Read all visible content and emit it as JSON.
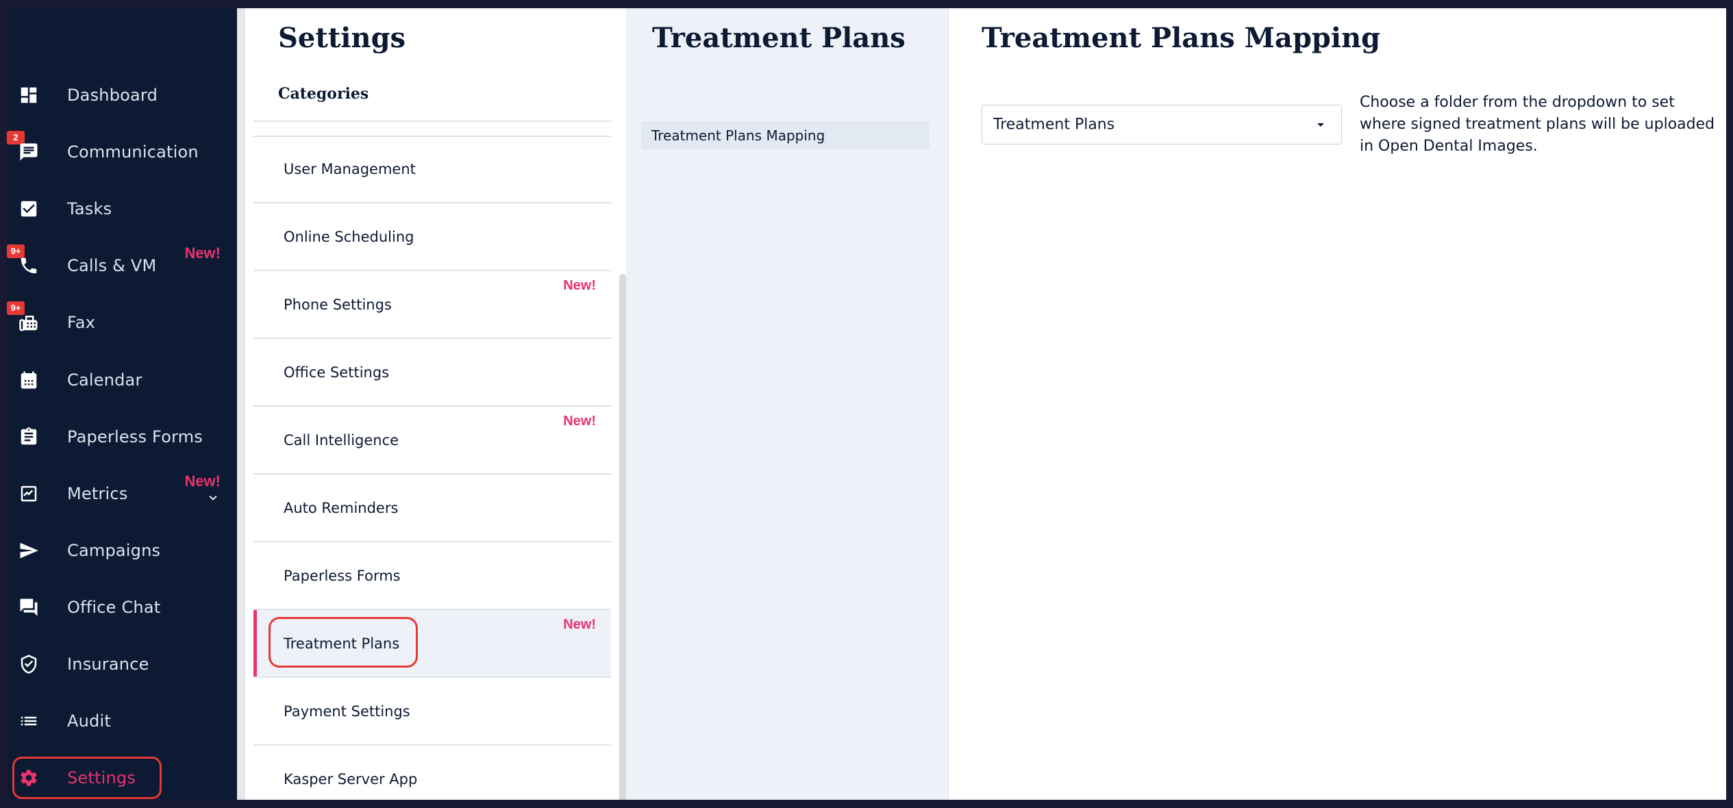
{
  "sidebar": {
    "items": [
      {
        "label": "Dashboard",
        "icon": "dashboard-icon"
      },
      {
        "label": "Communication",
        "icon": "chat-icon",
        "badge": "2"
      },
      {
        "label": "Tasks",
        "icon": "checkbox-icon"
      },
      {
        "label": "Calls & VM",
        "icon": "phone-icon",
        "badge": "9+",
        "new": "New!"
      },
      {
        "label": "Fax",
        "icon": "fax-icon",
        "badge": "9+"
      },
      {
        "label": "Calendar",
        "icon": "calendar-icon"
      },
      {
        "label": "Paperless Forms",
        "icon": "clipboard-icon"
      },
      {
        "label": "Metrics",
        "icon": "metrics-chart-icon",
        "new": "New!"
      },
      {
        "label": "Campaigns",
        "icon": "send-icon"
      },
      {
        "label": "Office Chat",
        "icon": "forum-icon"
      },
      {
        "label": "Insurance",
        "icon": "shield-icon"
      },
      {
        "label": "Audit",
        "icon": "list-icon"
      },
      {
        "label": "Settings",
        "icon": "gear-icon"
      }
    ],
    "active": "Settings"
  },
  "categories_panel": {
    "title": "Settings",
    "heading": "Categories",
    "items": [
      {
        "label": "User Management"
      },
      {
        "label": "Online Scheduling"
      },
      {
        "label": "Phone Settings",
        "new": "New!"
      },
      {
        "label": "Office Settings"
      },
      {
        "label": "Call Intelligence",
        "new": "New!"
      },
      {
        "label": "Auto Reminders"
      },
      {
        "label": "Paperless Forms"
      },
      {
        "label": "Treatment Plans",
        "new": "New!"
      },
      {
        "label": "Payment Settings"
      },
      {
        "label": "Kasper Server App"
      }
    ],
    "active": "Treatment Plans"
  },
  "subcategory_panel": {
    "title": "Treatment Plans",
    "items": [
      {
        "label": "Treatment Plans Mapping"
      }
    ]
  },
  "detail_panel": {
    "title": "Treatment Plans Mapping",
    "dropdown_value": "Treatment Plans",
    "help_text": "Choose a folder from the dropdown to set where signed treatment plans will be uploaded in Open Dental Images."
  },
  "colors": {
    "sidebar_bg": "#0c1a33",
    "accent": "#e8336d",
    "highlight": "#e53935",
    "panel_bg": "#eef1f7"
  }
}
